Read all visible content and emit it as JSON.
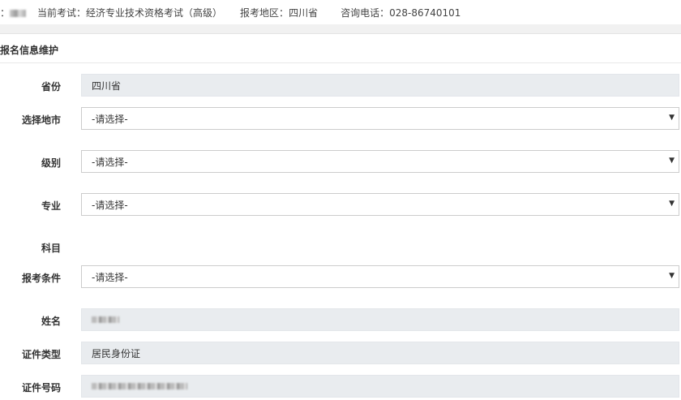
{
  "header": {
    "user_prefix": "：",
    "current_exam_label": "当前考试：",
    "current_exam": "经济专业技术资格考试（高级）",
    "region_label": "报考地区：",
    "region": "四川省",
    "phone_label": "咨询电话：",
    "phone": "028-86740101"
  },
  "panel_title": "报名信息维护",
  "fields": {
    "province": {
      "label": "省份",
      "value": "四川省"
    },
    "city": {
      "label": "选择地市",
      "value": "-请选择-"
    },
    "level": {
      "label": "级别",
      "value": "-请选择-"
    },
    "major": {
      "label": "专业",
      "value": "-请选择-"
    },
    "subject": {
      "label": "科目"
    },
    "condition": {
      "label": "报考条件",
      "value": "-请选择-"
    },
    "name": {
      "label": "姓名"
    },
    "id_type": {
      "label": "证件类型",
      "value": "居民身份证"
    },
    "id_number": {
      "label": "证件号码"
    }
  },
  "icons": {
    "dropdown": "▼"
  }
}
